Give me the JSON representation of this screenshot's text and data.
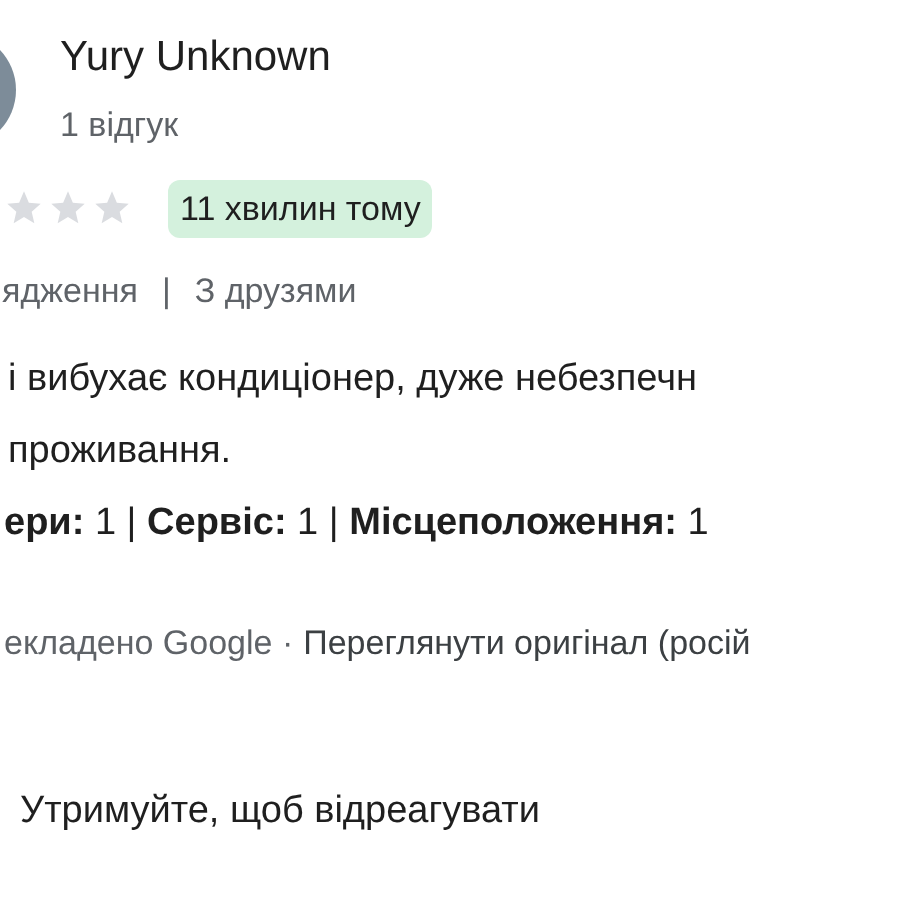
{
  "reviewer": {
    "name": "Yury Unknown",
    "reviews": "1 відгук"
  },
  "rating": {
    "stars": 0,
    "time": "11 хвилин тому"
  },
  "trip": {
    "type": "ядження",
    "separator": "|",
    "company": "З друзями"
  },
  "text": [
    "і вибухає кондиціонер, дуже небезпечн",
    "проживання."
  ],
  "scores": "**ери:** 1 | **Сервіс:** 1 | **Місцеположення:** 1",
  "translation": {
    "note": "екладено Google ·",
    "link": "Переглянути оригінал (росій"
  },
  "hold_hint": "Утримуйте, щоб відреагувати"
}
